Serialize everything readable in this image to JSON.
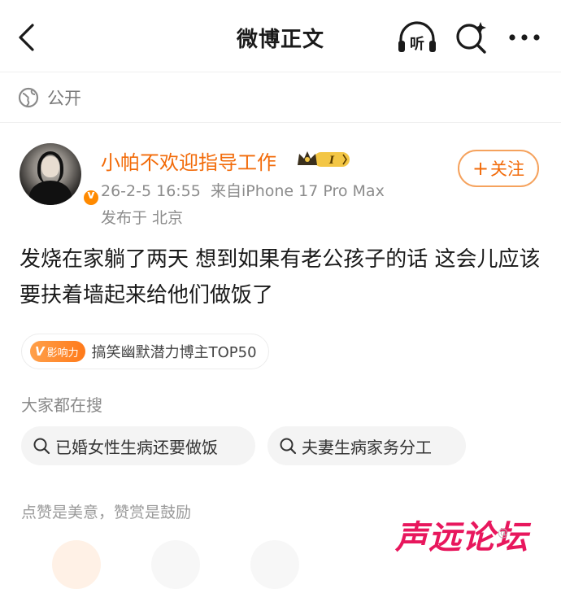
{
  "header": {
    "title": "微博正文",
    "back_icon": "chevron-left-icon",
    "listen_label": "听",
    "search_icon": "search-sparkle-icon",
    "more_icon": "more-dots-icon"
  },
  "visibility": {
    "icon": "globe-icon",
    "label": "公开"
  },
  "post": {
    "author": "小帕不欢迎指导工作",
    "member_badge": "I",
    "timestamp": "26-2-5 16:55",
    "source": "来自iPhone 17 Pro Max",
    "location": "发布于 北京",
    "follow_label": "关注",
    "text": "发烧在家躺了两天 想到如果有老公孩子的话 这会儿应该要扶着墙起来给他们做饭了"
  },
  "influence": {
    "badge_label": "影响力",
    "badge_letter": "V",
    "label": "搞笑幽默潜力博主TOP50"
  },
  "searches": {
    "title": "大家都在搜",
    "items": [
      "已婚女性生病还要做饭",
      "夫妻生病家务分工"
    ]
  },
  "footer": {
    "like_hint": "点赞是美意，赞赏是鼓励"
  },
  "watermark": {
    "text": "声远论坛",
    "sub": "@"
  },
  "colors": {
    "accent": "#f26b0a",
    "watermark": "#e8175d"
  }
}
